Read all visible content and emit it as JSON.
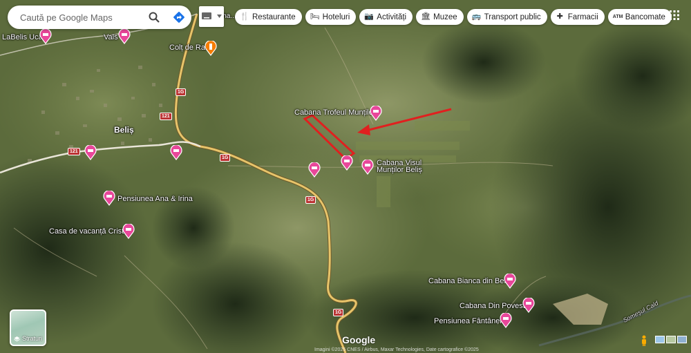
{
  "search": {
    "placeholder": "Caută pe Google Maps"
  },
  "chips": [
    {
      "label": "Restaurante",
      "icon": "fork-knife-icon"
    },
    {
      "label": "Hoteluri",
      "icon": "bed-icon"
    },
    {
      "label": "Activități",
      "icon": "camera-icon"
    },
    {
      "label": "Muzee",
      "icon": "museum-icon"
    },
    {
      "label": "Transport public",
      "icon": "bus-icon"
    },
    {
      "label": "Farmacii",
      "icon": "pharmacy-icon"
    },
    {
      "label": "Bancomate",
      "icon": "atm-icon"
    }
  ],
  "behind_chips_label": "Ma... Cha...",
  "layers": {
    "label": "Straturi"
  },
  "logo": "Google",
  "footer": "Imagini ©2025 CNES / Airbus, Maxar Technologies, Date cartografice ©2025",
  "places": {
    "labelis": "LaBelis Ucă",
    "vals": "Vals",
    "coltderai": "Colț de Rai",
    "belis": "Beliș",
    "trofeul": "Cabana Trofeul Munților",
    "visu1": "Cabana Visul",
    "visu2": "Munților Beliș",
    "ana": "Pensiunea Ana & Irina",
    "cristal": "Casa de vacanță Cristal",
    "bianca": "Cabana Bianca din Beliș",
    "poveste": "Cabana Din Poveste",
    "fantanele": "Pensiunea Fântânele",
    "somesul": "Someșul Cald"
  },
  "roads": {
    "r1": "1G",
    "r2": "121",
    "r3": "1G",
    "r4": "121",
    "r5": "1G",
    "r6": "1G"
  },
  "colors": {
    "hotel_pin": "#e8479a",
    "food_pin": "#f57c00",
    "road": "#e7c46a",
    "arrow": "#e0201f"
  }
}
